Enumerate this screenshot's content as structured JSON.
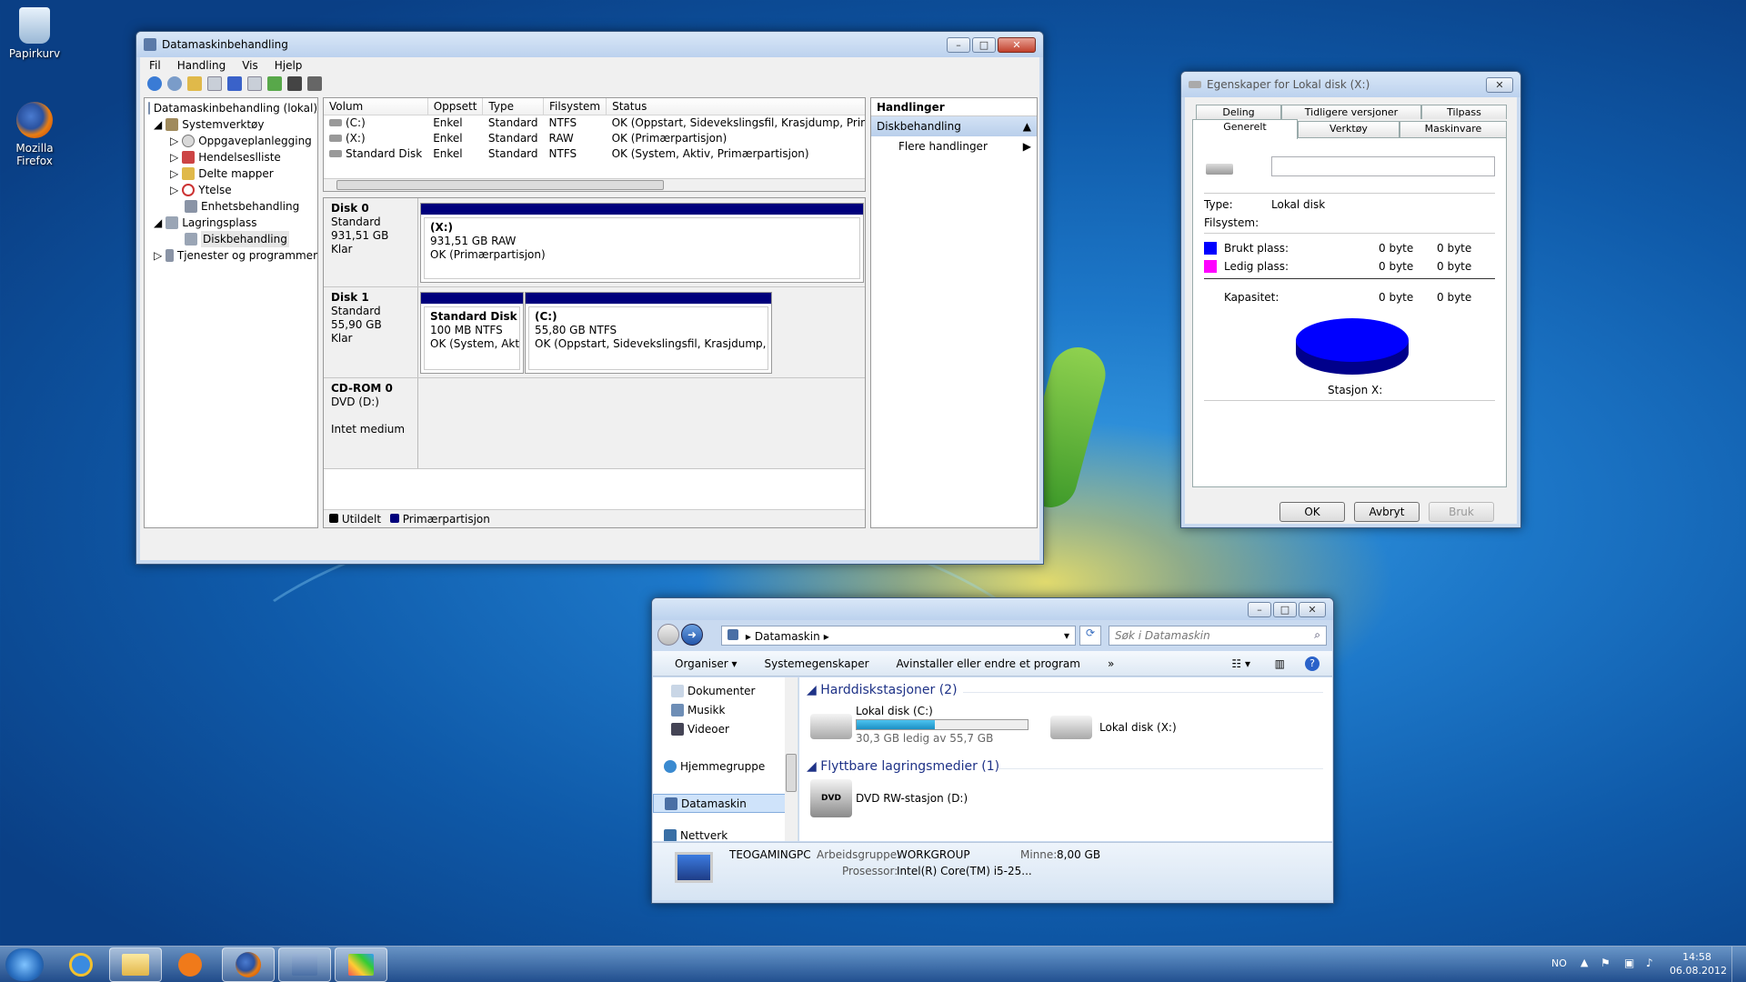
{
  "desktop": {
    "icons": [
      {
        "label": "Papirkurv"
      },
      {
        "label": "Mozilla Firefox"
      }
    ]
  },
  "diskmgmt": {
    "title": "Datamaskinbehandling",
    "menu": [
      "Fil",
      "Handling",
      "Vis",
      "Hjelp"
    ],
    "tree": [
      "Datamaskinbehandling (lokal)",
      "Systemverktøy",
      "Oppgaveplanlegging",
      "Hendelseslliste",
      "Delte mapper",
      "Ytelse",
      "Enhetsbehandling",
      "Lagringsplass",
      "Diskbehandling",
      "Tjenester og programmer"
    ],
    "columns": [
      "Volum",
      "Oppsett",
      "Type",
      "Filsystem",
      "Status"
    ],
    "volumes": [
      {
        "vol": "(C:)",
        "layout": "Enkel",
        "type": "Standard",
        "fs": "NTFS",
        "status": "OK (Oppstart, Sidevekslingsfil, Krasjdump, Primærpartisjon)"
      },
      {
        "vol": "(X:)",
        "layout": "Enkel",
        "type": "Standard",
        "fs": "RAW",
        "status": "OK (Primærpartisjon)"
      },
      {
        "vol": "Standard Disk",
        "layout": "Enkel",
        "type": "Standard",
        "fs": "NTFS",
        "status": "OK (System, Aktiv, Primærpartisjon)"
      }
    ],
    "disk0": {
      "name": "Disk 0",
      "type": "Standard",
      "size": "931,51 GB",
      "state": "Klar",
      "part_name": "(X:)",
      "part_size": "931,51 GB RAW",
      "part_status": "OK (Primærpartisjon)"
    },
    "disk1": {
      "name": "Disk 1",
      "type": "Standard",
      "size": "55,90 GB",
      "state": "Klar",
      "p1_name": "Standard Disk",
      "p1_size": "100 MB NTFS",
      "p1_status": "OK (System, Aktiv,",
      "p2_name": "(C:)",
      "p2_size": "55,80 GB NTFS",
      "p2_status": "OK (Oppstart, Sidevekslingsfil, Krasjdump, Primæ"
    },
    "cdrom": {
      "name": "CD-ROM 0",
      "type": "DVD (D:)",
      "state": "Intet medium"
    },
    "legend": [
      "Utildelt",
      "Primærpartisjon"
    ],
    "actions": {
      "header": "Handlinger",
      "section": "Diskbehandling",
      "more": "Flere handlinger"
    }
  },
  "props": {
    "title": "Egenskaper for Lokal disk (X:)",
    "tabs_top": [
      "Deling",
      "Tidligere versjoner",
      "Tilpass"
    ],
    "tabs_bottom": [
      "Generelt",
      "Verktøy",
      "Maskinvare"
    ],
    "type_label": "Type:",
    "type_value": "Lokal disk",
    "fs_label": "Filsystem:",
    "used_label": "Brukt plass:",
    "used_bytes": "0 byte",
    "used_bytes2": "0 byte",
    "free_label": "Ledig plass:",
    "free_bytes": "0 byte",
    "free_bytes2": "0 byte",
    "cap_label": "Kapasitet:",
    "cap_bytes": "0 byte",
    "cap_bytes2": "0 byte",
    "drive_label": "Stasjon X:",
    "ok": "OK",
    "cancel": "Avbryt",
    "apply": "Bruk",
    "used_color": "#0000ff",
    "free_color": "#ff00ff"
  },
  "explorer": {
    "address": "Datamaskin",
    "search_placeholder": "Søk i Datamaskin",
    "cmd": [
      "Organiser",
      "Systemegenskaper",
      "Avinstaller eller endre et program",
      "»"
    ],
    "nav": [
      "Dokumenter",
      "Musikk",
      "Videoer",
      "Hjemmegruppe",
      "Datamaskin",
      "Nettverk"
    ],
    "group1": "Harddiskstasjoner (2)",
    "drive_c": "Lokal disk (C:)",
    "drive_c_free": "30,3 GB ledig av 55,7 GB",
    "drive_c_used_fraction": 0.46,
    "drive_x": "Lokal disk (X:)",
    "group2": "Flyttbare lagringsmedier (1)",
    "dvd": "DVD RW-stasjon (D:)",
    "pc_name": "TEOGAMINGPC",
    "wg_label": "Arbeidsgruppe:",
    "wg_value": "WORKGROUP",
    "mem_label": "Minne:",
    "mem_value": "8,00 GB",
    "cpu_label": "Prosessor:",
    "cpu_value": "Intel(R) Core(TM) i5-25..."
  },
  "taskbar": {
    "lang": "NO",
    "time": "14:58",
    "date": "06.08.2012"
  }
}
